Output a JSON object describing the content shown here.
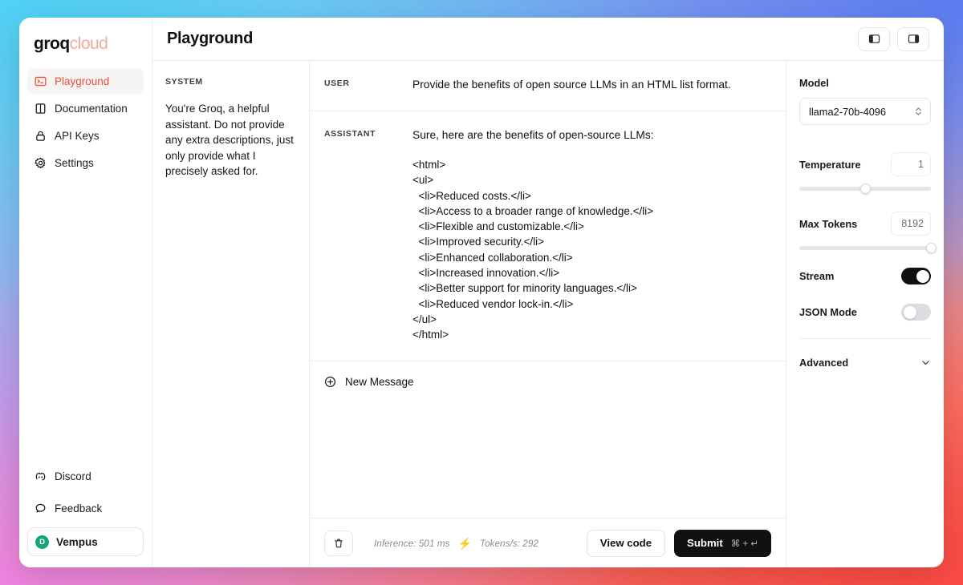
{
  "brand": {
    "logo_primary": "groq",
    "logo_secondary": "cloud",
    "accent_color": "#ef4e3a",
    "logo_secondary_color": "#f2a99f"
  },
  "sidebar": {
    "items": [
      {
        "label": "Playground",
        "icon": "terminal-icon",
        "active": true
      },
      {
        "label": "Documentation",
        "icon": "book-icon",
        "active": false
      },
      {
        "label": "API Keys",
        "icon": "lock-icon",
        "active": false
      },
      {
        "label": "Settings",
        "icon": "gear-icon",
        "active": false
      }
    ],
    "bottom_items": [
      {
        "label": "Discord",
        "icon": "discord-icon"
      },
      {
        "label": "Feedback",
        "icon": "chat-bubble-icon"
      }
    ],
    "account": {
      "name": "Vempus",
      "avatar_initial": "D",
      "avatar_color": "#17a673"
    }
  },
  "header": {
    "title": "Playground",
    "left_panel_toggle": "left-panel-toggle-icon",
    "right_panel_toggle": "right-panel-toggle-icon"
  },
  "system_panel": {
    "label": "SYSTEM",
    "text": "You're Groq, a helpful assistant. Do not provide any extra descriptions, just only provide what I precisely asked for."
  },
  "conversation": {
    "messages": [
      {
        "role": "USER",
        "text": "Provide the benefits of open source LLMs in an HTML list format.",
        "code": ""
      },
      {
        "role": "ASSISTANT",
        "text": "Sure, here are the benefits of open-source LLMs:",
        "code": "<html>\n<ul>\n  <li>Reduced costs.</li>\n  <li>Access to a broader range of knowledge.</li>\n  <li>Flexible and customizable.</li>\n  <li>Improved security.</li>\n  <li>Enhanced collaboration.</li>\n  <li>Increased innovation.</li>\n  <li>Better support for minority languages.</li>\n  <li>Reduced vendor lock-in.</li>\n</ul>\n</html>"
      }
    ],
    "new_message_label": "New Message",
    "new_message_icon": "plus-circle-icon"
  },
  "footer": {
    "delete_icon": "trash-icon",
    "inference_stat": "Inference: 501 ms",
    "bolt_icon": "lightning-bolt-icon",
    "bolt_color": "#f2624f",
    "tokens_stat": "Tokens/s: 292",
    "view_code_label": "View code",
    "submit_label": "Submit",
    "submit_shortcut": "⌘ + ↵"
  },
  "settings": {
    "model": {
      "label": "Model",
      "value": "llama2-70b-4096",
      "chevron_icon": "chevron-up-down-icon"
    },
    "temperature": {
      "label": "Temperature",
      "value": "1",
      "slider_percent": 50
    },
    "max_tokens": {
      "label": "Max Tokens",
      "value": "8192",
      "slider_percent": 100
    },
    "stream": {
      "label": "Stream",
      "enabled": true
    },
    "json_mode": {
      "label": "JSON Mode",
      "enabled": false
    },
    "advanced": {
      "label": "Advanced",
      "chevron_icon": "chevron-down-icon"
    }
  }
}
